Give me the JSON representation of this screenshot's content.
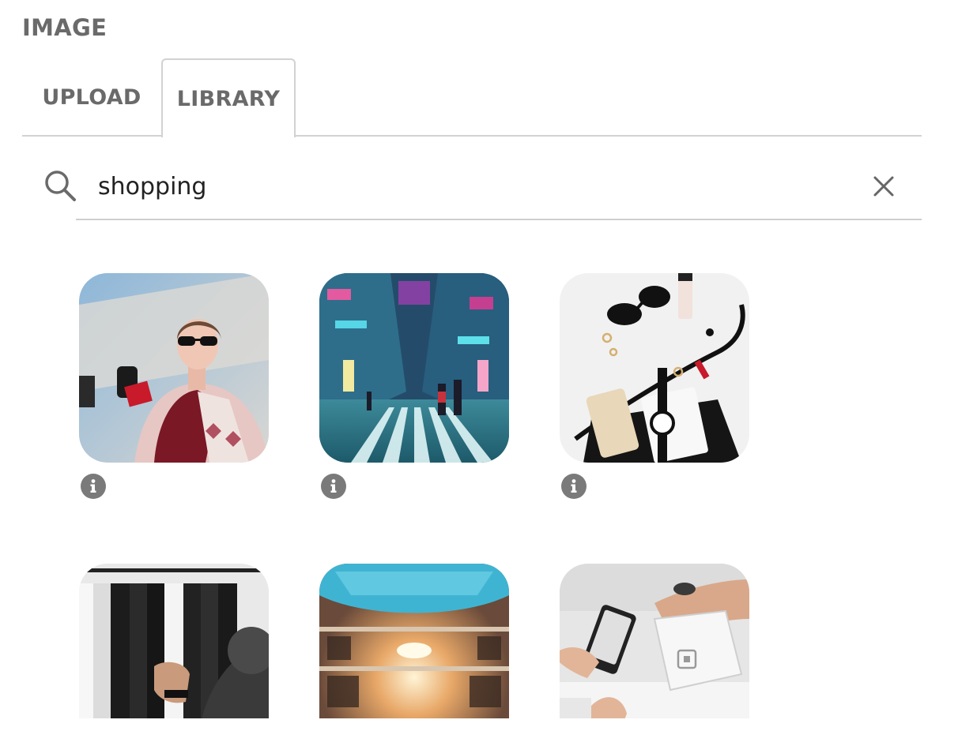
{
  "section": {
    "title": "IMAGE"
  },
  "tabs": [
    {
      "label": "UPLOAD",
      "active": false
    },
    {
      "label": "LIBRARY",
      "active": true
    }
  ],
  "search": {
    "value": "shopping",
    "icon": "search-icon",
    "clear_icon": "close-icon"
  },
  "images": [
    {
      "subject": "woman in sunglasses with shopping bags",
      "info_icon": "info-icon"
    },
    {
      "subject": "neon city street crosswalk",
      "info_icon": "info-icon"
    },
    {
      "subject": "handbag flat lay with watch, sunglasses, phone",
      "info_icon": "info-icon"
    },
    {
      "subject": "clothing rack with shirts"
    },
    {
      "subject": "shopping mall interior"
    },
    {
      "subject": "card payment at point of sale terminal"
    }
  ],
  "colors": {
    "text_gray": "#6a6a6a",
    "divider": "#d2d2d2",
    "info_button": "#7a7a7a"
  }
}
